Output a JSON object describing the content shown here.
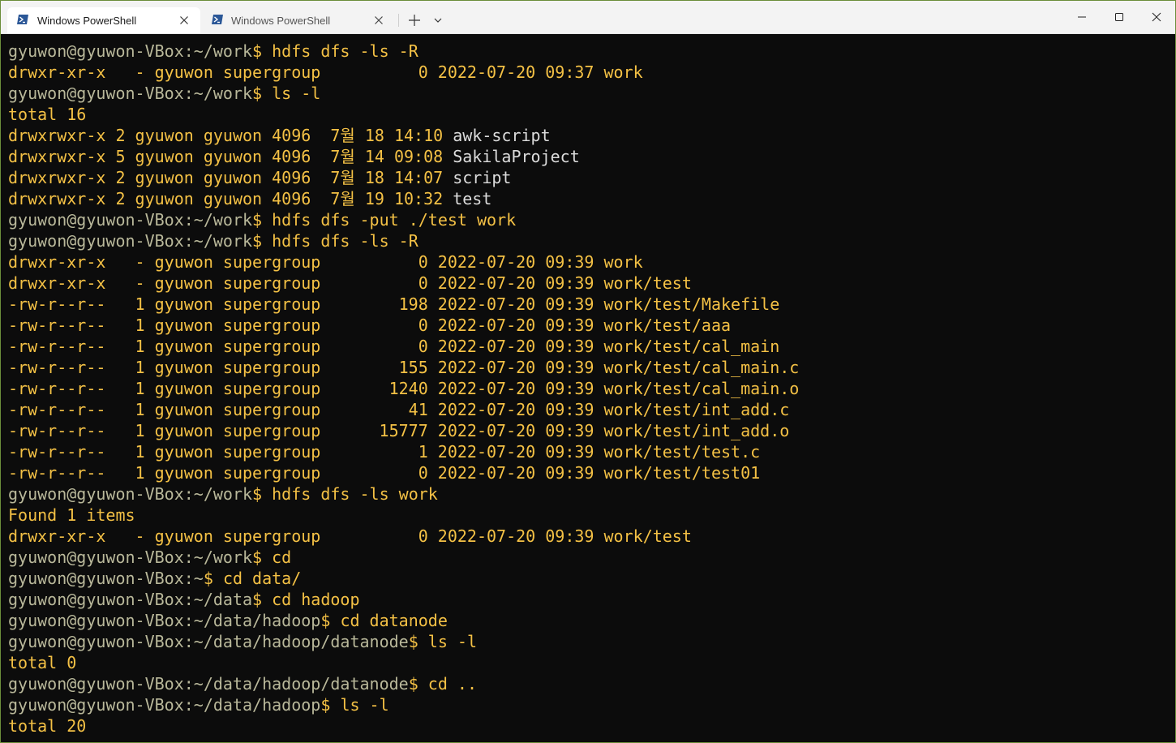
{
  "window": {
    "tabs": [
      {
        "label": "Windows PowerShell",
        "icon": "powershell-icon",
        "active": true
      },
      {
        "label": "Windows PowerShell",
        "icon": "powershell-icon",
        "active": false
      }
    ],
    "new_tab_icon": "plus-icon",
    "dropdown_icon": "chevron-down-icon",
    "controls": [
      "minimize-icon",
      "maximize-icon",
      "close-icon"
    ],
    "border_color": "#6b8e3a"
  },
  "terminal": {
    "background": "#0c0c0c",
    "foreground": "#f4c145",
    "prompt_color": "#b9b89a",
    "lines": [
      {
        "user": "gyuwon@gyuwon-VBox",
        "path": "~/work",
        "cmd": "hdfs dfs -ls -R"
      },
      {
        "out": "drwxr-xr-x   - gyuwon supergroup          0 2022-07-20 09:37 work"
      },
      {
        "user": "gyuwon@gyuwon-VBox",
        "path": "~/work",
        "cmd": "ls -l"
      },
      {
        "out": "total 16"
      },
      {
        "out": "drwxrwxr-x 2 gyuwon gyuwon 4096  7월 18 14:10 ",
        "name": "awk-script"
      },
      {
        "out": "drwxrwxr-x 5 gyuwon gyuwon 4096  7월 14 09:08 ",
        "name": "SakilaProject"
      },
      {
        "out": "drwxrwxr-x 2 gyuwon gyuwon 4096  7월 18 14:07 ",
        "name": "script"
      },
      {
        "out": "drwxrwxr-x 2 gyuwon gyuwon 4096  7월 19 10:32 ",
        "name": "test"
      },
      {
        "user": "gyuwon@gyuwon-VBox",
        "path": "~/work",
        "cmd": "hdfs dfs -put ./test work"
      },
      {
        "user": "gyuwon@gyuwon-VBox",
        "path": "~/work",
        "cmd": "hdfs dfs -ls -R"
      },
      {
        "out": "drwxr-xr-x   - gyuwon supergroup          0 2022-07-20 09:39 work"
      },
      {
        "out": "drwxr-xr-x   - gyuwon supergroup          0 2022-07-20 09:39 work/test"
      },
      {
        "out": "-rw-r--r--   1 gyuwon supergroup        198 2022-07-20 09:39 work/test/Makefile"
      },
      {
        "out": "-rw-r--r--   1 gyuwon supergroup          0 2022-07-20 09:39 work/test/aaa"
      },
      {
        "out": "-rw-r--r--   1 gyuwon supergroup          0 2022-07-20 09:39 work/test/cal_main"
      },
      {
        "out": "-rw-r--r--   1 gyuwon supergroup        155 2022-07-20 09:39 work/test/cal_main.c"
      },
      {
        "out": "-rw-r--r--   1 gyuwon supergroup       1240 2022-07-20 09:39 work/test/cal_main.o"
      },
      {
        "out": "-rw-r--r--   1 gyuwon supergroup         41 2022-07-20 09:39 work/test/int_add.c"
      },
      {
        "out": "-rw-r--r--   1 gyuwon supergroup      15777 2022-07-20 09:39 work/test/int_add.o"
      },
      {
        "out": "-rw-r--r--   1 gyuwon supergroup          1 2022-07-20 09:39 work/test/test.c"
      },
      {
        "out": "-rw-r--r--   1 gyuwon supergroup          0 2022-07-20 09:39 work/test/test01"
      },
      {
        "user": "gyuwon@gyuwon-VBox",
        "path": "~/work",
        "cmd": "hdfs dfs -ls work"
      },
      {
        "out": "Found 1 items"
      },
      {
        "out": "drwxr-xr-x   - gyuwon supergroup          0 2022-07-20 09:39 work/test"
      },
      {
        "user": "gyuwon@gyuwon-VBox",
        "path": "~/work",
        "cmd": "cd"
      },
      {
        "user": "gyuwon@gyuwon-VBox",
        "path": "~",
        "cmd": "cd data/"
      },
      {
        "user": "gyuwon@gyuwon-VBox",
        "path": "~/data",
        "cmd": "cd hadoop"
      },
      {
        "user": "gyuwon@gyuwon-VBox",
        "path": "~/data/hadoop",
        "cmd": "cd datanode"
      },
      {
        "user": "gyuwon@gyuwon-VBox",
        "path": "~/data/hadoop/datanode",
        "cmd": "ls -l"
      },
      {
        "out": "total 0"
      },
      {
        "user": "gyuwon@gyuwon-VBox",
        "path": "~/data/hadoop/datanode",
        "cmd": "cd .."
      },
      {
        "user": "gyuwon@gyuwon-VBox",
        "path": "~/data/hadoop",
        "cmd": "ls -l"
      },
      {
        "out": "total 20"
      }
    ]
  }
}
